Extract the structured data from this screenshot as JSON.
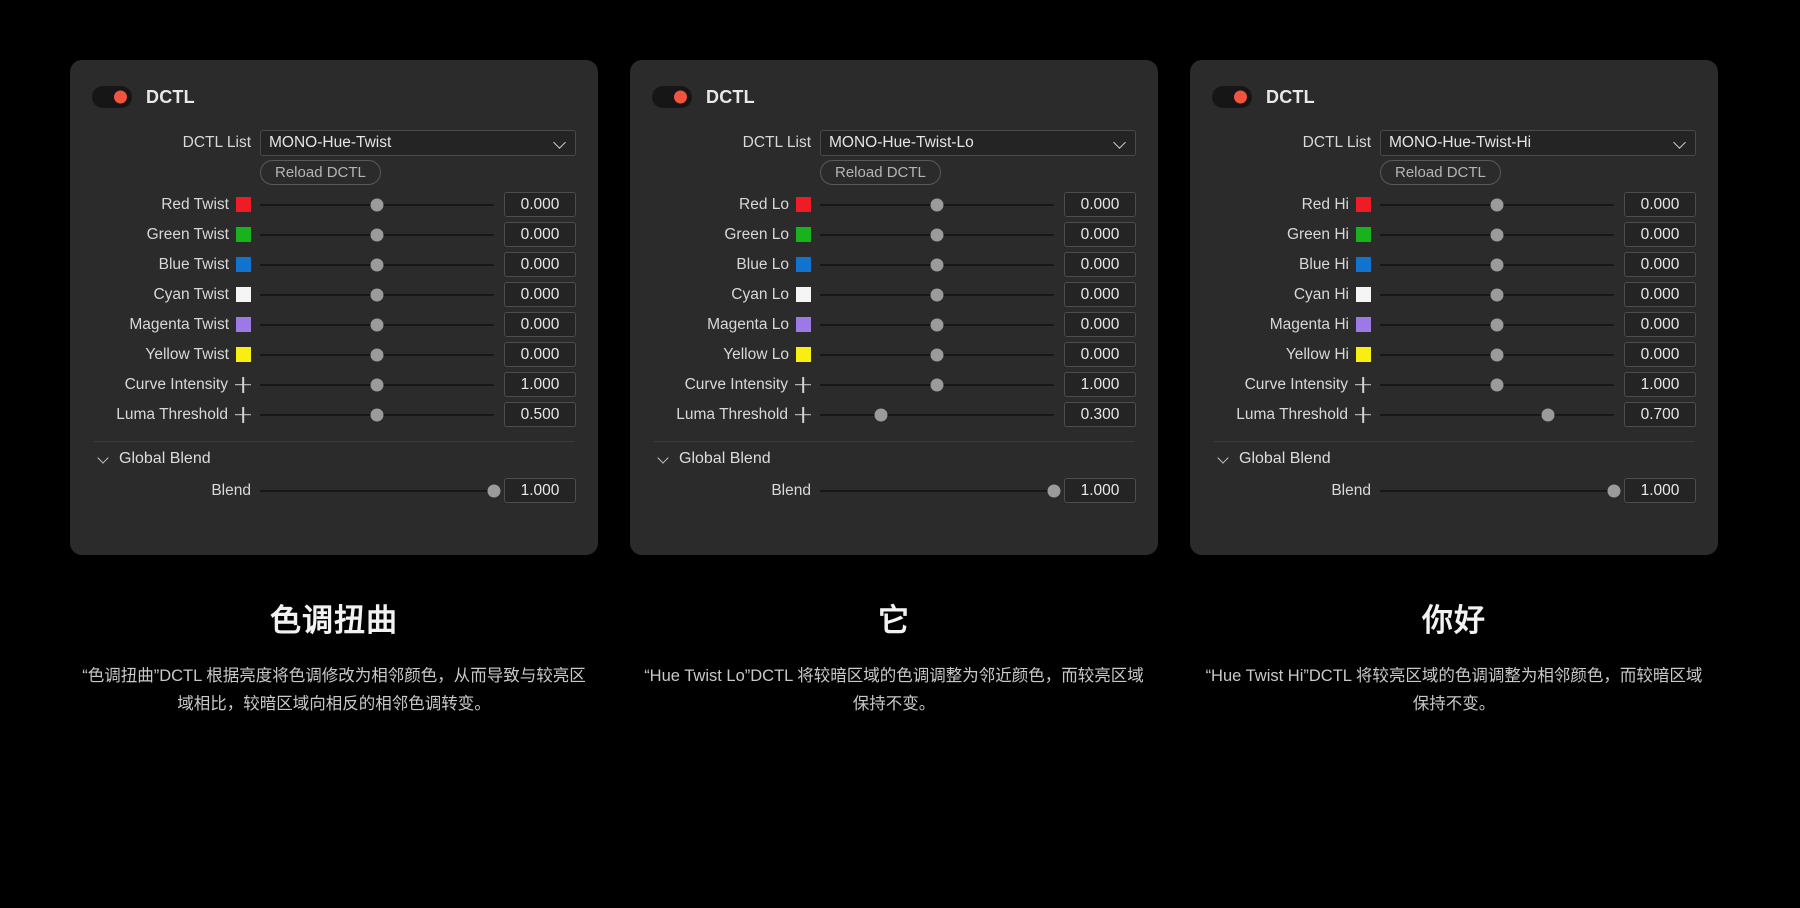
{
  "panels": [
    {
      "toggle_on": true,
      "header_title": "DCTL",
      "dctl_list_label": "DCTL List",
      "dctl_list_value": "MONO-Hue-Twist",
      "reload_label": "Reload DCTL",
      "rows": [
        {
          "label": "Red Twist",
          "icon": "color-swatch",
          "color": "#ee1c25",
          "value": "0.000",
          "pct": 50
        },
        {
          "label": "Green Twist",
          "icon": "color-swatch",
          "color": "#16b41a",
          "value": "0.000",
          "pct": 50
        },
        {
          "label": "Blue Twist",
          "icon": "color-swatch",
          "color": "#1273cf",
          "value": "0.000",
          "pct": 50
        },
        {
          "label": "Cyan Twist",
          "icon": "color-swatch",
          "color": "#f5f5f5",
          "value": "0.000",
          "pct": 50
        },
        {
          "label": "Magenta Twist",
          "icon": "color-swatch",
          "color": "#9b7ae6",
          "value": "0.000",
          "pct": 50
        },
        {
          "label": "Yellow Twist",
          "icon": "color-swatch",
          "color": "#f8ee12",
          "value": "0.000",
          "pct": 50
        },
        {
          "label": "Curve Intensity",
          "icon": "keyframe-plus",
          "color": "",
          "value": "1.000",
          "pct": 50
        },
        {
          "label": "Luma Threshold",
          "icon": "keyframe-plus",
          "color": "",
          "value": "0.500",
          "pct": 50
        }
      ],
      "section_title": "Global Blend",
      "blend_label": "Blend",
      "blend_value": "1.000",
      "blend_pct": 100,
      "caption_title": "色调扭曲",
      "caption_desc": "“色调扭曲”DCTL 根据亮度将色调修改为相邻颜色，从而导致与较亮区域相比，较暗区域向相反的相邻色调转变。"
    },
    {
      "toggle_on": true,
      "header_title": "DCTL",
      "dctl_list_label": "DCTL List",
      "dctl_list_value": "MONO-Hue-Twist-Lo",
      "reload_label": "Reload DCTL",
      "rows": [
        {
          "label": "Red Lo",
          "icon": "color-swatch",
          "color": "#ee1c25",
          "value": "0.000",
          "pct": 50
        },
        {
          "label": "Green Lo",
          "icon": "color-swatch",
          "color": "#16b41a",
          "value": "0.000",
          "pct": 50
        },
        {
          "label": "Blue Lo",
          "icon": "color-swatch",
          "color": "#1273cf",
          "value": "0.000",
          "pct": 50
        },
        {
          "label": "Cyan Lo",
          "icon": "color-swatch",
          "color": "#f5f5f5",
          "value": "0.000",
          "pct": 50
        },
        {
          "label": "Magenta Lo",
          "icon": "color-swatch",
          "color": "#9b7ae6",
          "value": "0.000",
          "pct": 50
        },
        {
          "label": "Yellow Lo",
          "icon": "color-swatch",
          "color": "#f8ee12",
          "value": "0.000",
          "pct": 50
        },
        {
          "label": "Curve Intensity",
          "icon": "keyframe-plus",
          "color": "",
          "value": "1.000",
          "pct": 50
        },
        {
          "label": "Luma Threshold",
          "icon": "keyframe-plus",
          "color": "",
          "value": "0.300",
          "pct": 26
        }
      ],
      "section_title": "Global Blend",
      "blend_label": "Blend",
      "blend_value": "1.000",
      "blend_pct": 100,
      "caption_title": "它",
      "caption_desc": "“Hue Twist Lo”DCTL 将较暗区域的色调调整为邻近颜色，而较亮区域保持不变。"
    },
    {
      "toggle_on": true,
      "header_title": "DCTL",
      "dctl_list_label": "DCTL List",
      "dctl_list_value": "MONO-Hue-Twist-Hi",
      "reload_label": "Reload DCTL",
      "rows": [
        {
          "label": "Red Hi",
          "icon": "color-swatch",
          "color": "#ee1c25",
          "value": "0.000",
          "pct": 50
        },
        {
          "label": "Green Hi",
          "icon": "color-swatch",
          "color": "#16b41a",
          "value": "0.000",
          "pct": 50
        },
        {
          "label": "Blue Hi",
          "icon": "color-swatch",
          "color": "#1273cf",
          "value": "0.000",
          "pct": 50
        },
        {
          "label": "Cyan Hi",
          "icon": "color-swatch",
          "color": "#f5f5f5",
          "value": "0.000",
          "pct": 50
        },
        {
          "label": "Magenta Hi",
          "icon": "color-swatch",
          "color": "#9b7ae6",
          "value": "0.000",
          "pct": 50
        },
        {
          "label": "Yellow Hi",
          "icon": "color-swatch",
          "color": "#f8ee12",
          "value": "0.000",
          "pct": 50
        },
        {
          "label": "Curve Intensity",
          "icon": "keyframe-plus",
          "color": "",
          "value": "1.000",
          "pct": 50
        },
        {
          "label": "Luma Threshold",
          "icon": "keyframe-plus",
          "color": "",
          "value": "0.700",
          "pct": 72
        }
      ],
      "section_title": "Global Blend",
      "blend_label": "Blend",
      "blend_value": "1.000",
      "blend_pct": 100,
      "caption_title": "你好",
      "caption_desc": "“Hue Twist Hi”DCTL 将较亮区域的色调调整为相邻颜色，而较暗区域保持不变。"
    }
  ],
  "theme": {
    "background": "#000000",
    "panel_bg": "#2b2b2b",
    "accent": "#f05340",
    "text": "#e8e8e8"
  }
}
